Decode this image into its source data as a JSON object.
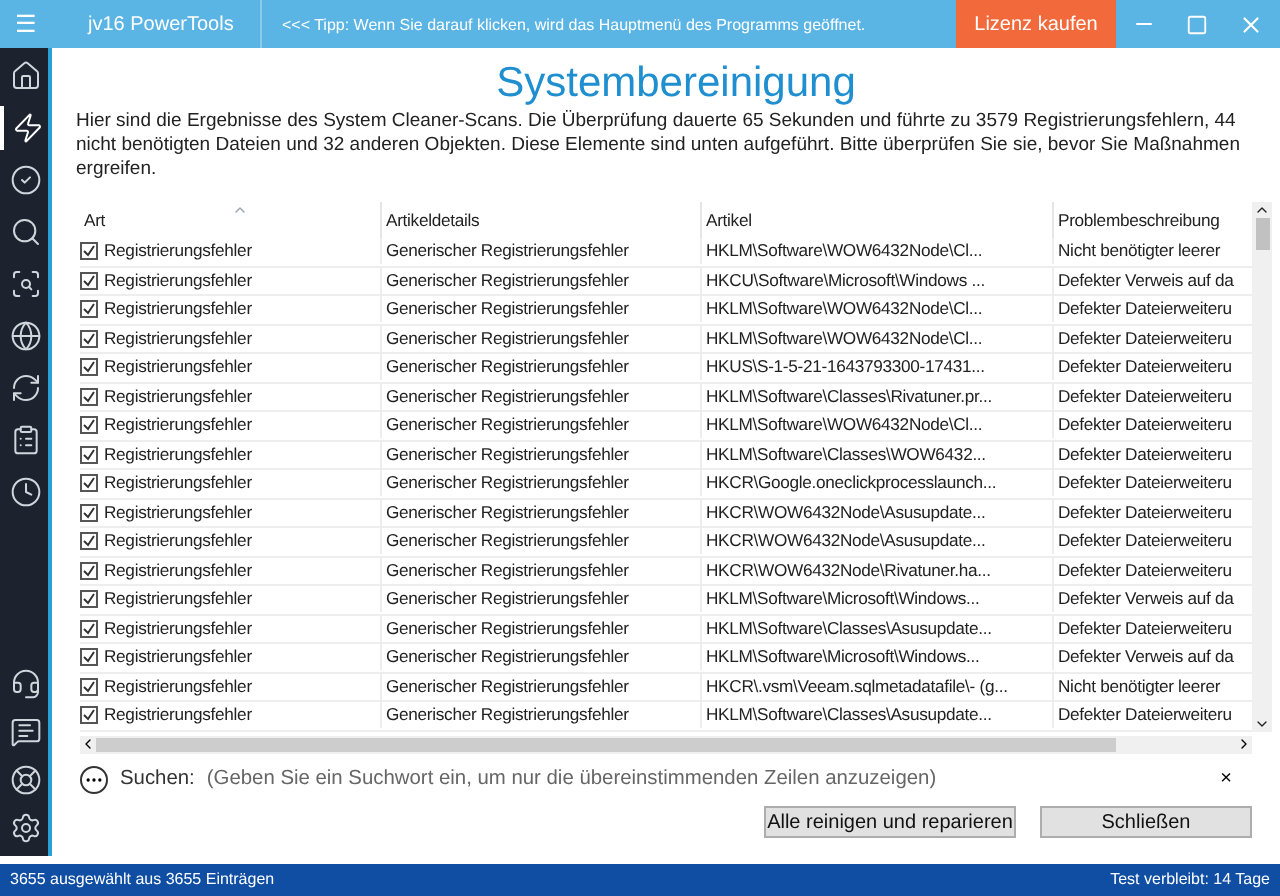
{
  "window": {
    "menu_icon": "☰",
    "app_name": "jv16 PowerTools",
    "tip": "<<< Tipp: Wenn Sie darauf klicken, wird das Hauptmenü des Programms geöffnet.",
    "buy_button": "Lizenz kaufen"
  },
  "sidebar": {
    "items": [
      {
        "selected": false
      },
      {
        "selected": true
      },
      {
        "selected": false
      },
      {
        "selected": false
      },
      {
        "selected": false
      },
      {
        "selected": false
      },
      {
        "selected": false
      },
      {
        "selected": false
      },
      {
        "selected": false
      }
    ],
    "bottom_items": [
      {
        "selected": false
      },
      {
        "selected": false
      },
      {
        "selected": false
      },
      {
        "selected": false
      }
    ]
  },
  "title": "Systembereinigung",
  "description": "Hier sind die Ergebnisse des System Cleaner-Scans. Die Überprüfung dauerte 65 Sekunden und führte zu 3579 Registrierungsfehlern, 44 nicht benötigten Dateien und 32 anderen Objekten. Diese Elemente sind unten aufgeführt. Bitte überprüfen Sie sie, bevor Sie Maßnahmen ergreifen.",
  "table": {
    "columns": [
      "Art",
      "Artikeldetails",
      "Artikel",
      "Problembeschreibung"
    ],
    "rows": [
      {
        "checked": true,
        "cells": [
          "Registrierungsfehler",
          "Generischer Registrierungsfehler",
          "HKLM\\Software\\WOW6432Node\\Cl...",
          "Nicht benötigter leerer"
        ]
      },
      {
        "checked": true,
        "cells": [
          "Registrierungsfehler",
          "Generischer Registrierungsfehler",
          "HKCU\\Software\\Microsoft\\Windows ...",
          "Defekter Verweis auf da"
        ]
      },
      {
        "checked": true,
        "cells": [
          "Registrierungsfehler",
          "Generischer Registrierungsfehler",
          "HKLM\\Software\\WOW6432Node\\Cl...",
          "Defekter Dateierweiteru"
        ]
      },
      {
        "checked": true,
        "cells": [
          "Registrierungsfehler",
          "Generischer Registrierungsfehler",
          "HKLM\\Software\\WOW6432Node\\Cl...",
          "Defekter Dateierweiteru"
        ]
      },
      {
        "checked": true,
        "cells": [
          "Registrierungsfehler",
          "Generischer Registrierungsfehler",
          "HKUS\\S-1-5-21-1643793300-17431...",
          "Defekter Dateierweiteru"
        ]
      },
      {
        "checked": true,
        "cells": [
          "Registrierungsfehler",
          "Generischer Registrierungsfehler",
          "HKLM\\Software\\Classes\\Rivatuner.pr...",
          "Defekter Dateierweiteru"
        ]
      },
      {
        "checked": true,
        "cells": [
          "Registrierungsfehler",
          "Generischer Registrierungsfehler",
          "HKLM\\Software\\WOW6432Node\\Cl...",
          "Defekter Dateierweiteru"
        ]
      },
      {
        "checked": true,
        "cells": [
          "Registrierungsfehler",
          "Generischer Registrierungsfehler",
          "HKLM\\Software\\Classes\\WOW6432...",
          "Defekter Dateierweiteru"
        ]
      },
      {
        "checked": true,
        "cells": [
          "Registrierungsfehler",
          "Generischer Registrierungsfehler",
          "HKCR\\Google.oneclickprocesslaunch...",
          "Defekter Dateierweiteru"
        ]
      },
      {
        "checked": true,
        "cells": [
          "Registrierungsfehler",
          "Generischer Registrierungsfehler",
          "HKCR\\WOW6432Node\\Asusupdate...",
          "Defekter Dateierweiteru"
        ]
      },
      {
        "checked": true,
        "cells": [
          "Registrierungsfehler",
          "Generischer Registrierungsfehler",
          "HKCR\\WOW6432Node\\Asusupdate...",
          "Defekter Dateierweiteru"
        ]
      },
      {
        "checked": true,
        "cells": [
          "Registrierungsfehler",
          "Generischer Registrierungsfehler",
          "HKCR\\WOW6432Node\\Rivatuner.ha...",
          "Defekter Dateierweiteru"
        ]
      },
      {
        "checked": true,
        "cells": [
          "Registrierungsfehler",
          "Generischer Registrierungsfehler",
          "HKLM\\Software\\Microsoft\\Windows...",
          "Defekter Verweis auf da"
        ]
      },
      {
        "checked": true,
        "cells": [
          "Registrierungsfehler",
          "Generischer Registrierungsfehler",
          "HKLM\\Software\\Classes\\Asusupdate...",
          "Defekter Dateierweiteru"
        ]
      },
      {
        "checked": true,
        "cells": [
          "Registrierungsfehler",
          "Generischer Registrierungsfehler",
          "HKLM\\Software\\Microsoft\\Windows...",
          "Defekter Verweis auf da"
        ]
      },
      {
        "checked": true,
        "cells": [
          "Registrierungsfehler",
          "Generischer Registrierungsfehler",
          "HKCR\\.vsm\\Veeam.sqlmetadatafile\\- (g...",
          "Nicht benötigter leerer"
        ]
      },
      {
        "checked": true,
        "cells": [
          "Registrierungsfehler",
          "Generischer Registrierungsfehler",
          "HKLM\\Software\\Classes\\Asusupdate...",
          "Defekter Dateierweiteru"
        ]
      }
    ]
  },
  "search": {
    "label": "Suchen:",
    "placeholder": "(Geben Sie ein Suchwort ein, um nur die übereinstimmenden Zeilen anzuzeigen)",
    "clear": "×"
  },
  "buttons": [
    "Alle reinigen und reparieren",
    "Schließen"
  ],
  "status_bar": {
    "left": "3655 ausgewählt aus 3655 Einträgen",
    "right": "Test verbleibt: 14 Tage"
  }
}
